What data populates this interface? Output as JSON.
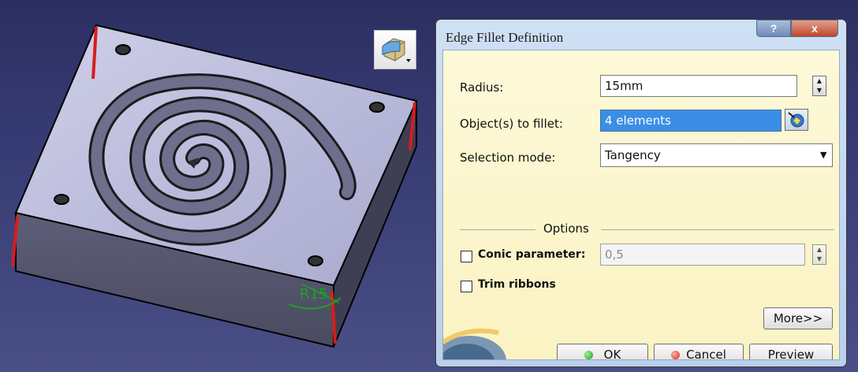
{
  "dialog": {
    "title": "Edge Fillet Definition",
    "help_label": "?",
    "close_label": "x",
    "radius_label": "Radius:",
    "radius_value": "15mm",
    "objects_label": "Object(s) to fillet:",
    "objects_value": "4 elements",
    "selection_mode_label": "Selection mode:",
    "selection_mode_value": "Tangency",
    "options_label": "Options",
    "conic_label": "Conic parameter:",
    "conic_value": "0,5",
    "conic_checked": false,
    "trim_label": "Trim ribbons",
    "trim_checked": false,
    "more_label": "More>>",
    "ok_label": "OK",
    "cancel_label": "Cancel",
    "preview_label": "Preview"
  },
  "viewport": {
    "dimension_label": "R15",
    "toolbar_icon": "edge-fillet-icon"
  },
  "colors": {
    "selected_edge": "#d81c1c",
    "dimension": "#1aa51a",
    "selection_highlight": "#3b8ee6",
    "background_top": "#2c2f60",
    "background_bottom": "#4a4f86"
  }
}
